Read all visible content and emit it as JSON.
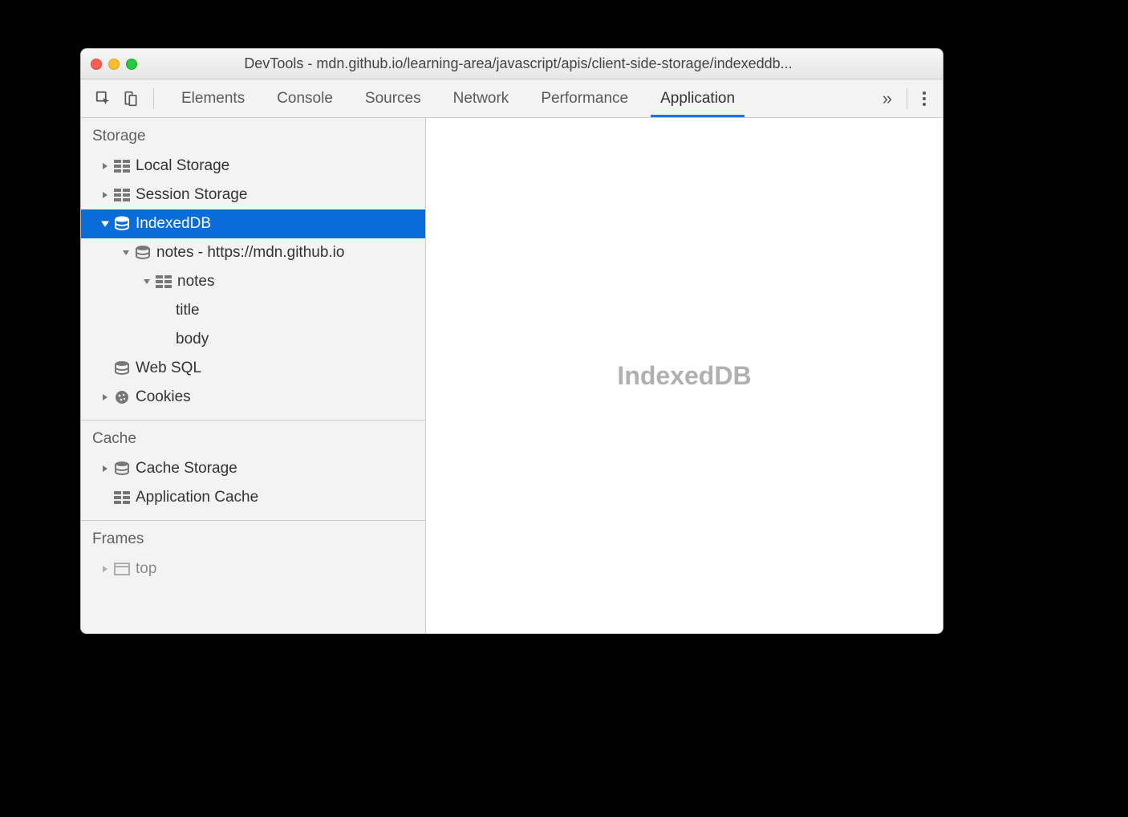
{
  "window": {
    "title": "DevTools - mdn.github.io/learning-area/javascript/apis/client-side-storage/indexeddb..."
  },
  "tabs": {
    "items": [
      "Elements",
      "Console",
      "Sources",
      "Network",
      "Performance",
      "Application"
    ],
    "active": "Application",
    "overflow_glyph": "»"
  },
  "sidebar": {
    "storage": {
      "header": "Storage",
      "local_storage": "Local Storage",
      "session_storage": "Session Storage",
      "indexeddb": "IndexedDB",
      "db_notes_origin": "notes - https://mdn.github.io",
      "store_notes": "notes",
      "index_title": "title",
      "index_body": "body",
      "web_sql": "Web SQL",
      "cookies": "Cookies"
    },
    "cache": {
      "header": "Cache",
      "cache_storage": "Cache Storage",
      "application_cache": "Application Cache"
    },
    "frames": {
      "header": "Frames",
      "top": "top"
    }
  },
  "main": {
    "placeholder": "IndexedDB"
  }
}
